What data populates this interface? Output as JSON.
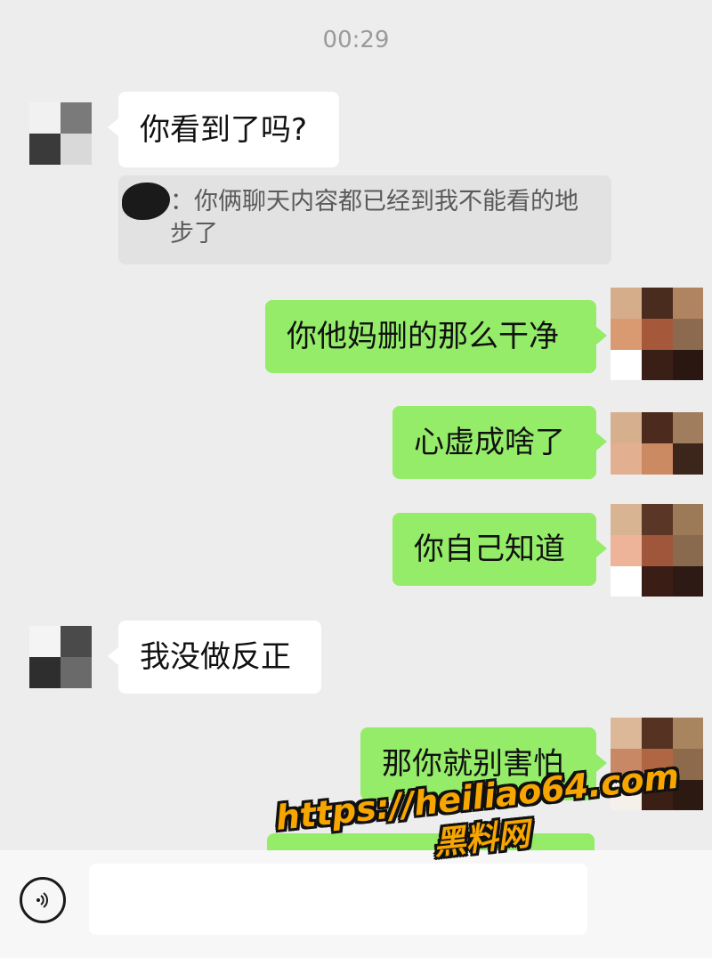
{
  "status": {
    "time": "00:29"
  },
  "messages": [
    {
      "side": "left",
      "text": "你看到了吗?"
    },
    {
      "side": "quote",
      "text": "：你俩聊天内容都已经到我不能看的地步了"
    },
    {
      "side": "right",
      "text": "你他妈删的那么干净"
    },
    {
      "side": "right",
      "text": "心虚成啥了"
    },
    {
      "side": "right",
      "text": "你自己知道"
    },
    {
      "side": "left",
      "text": "我没做反正"
    },
    {
      "side": "right",
      "text": "那你就别害怕"
    }
  ],
  "watermark": {
    "url": "https://heiliao64.com",
    "name": "黑料网"
  },
  "icons": {
    "voice": "voice-icon"
  },
  "colors": {
    "background": "#ededed",
    "sent_bubble": "#95ec69",
    "received_bubble": "#ffffff",
    "watermark": "#f7a600"
  }
}
